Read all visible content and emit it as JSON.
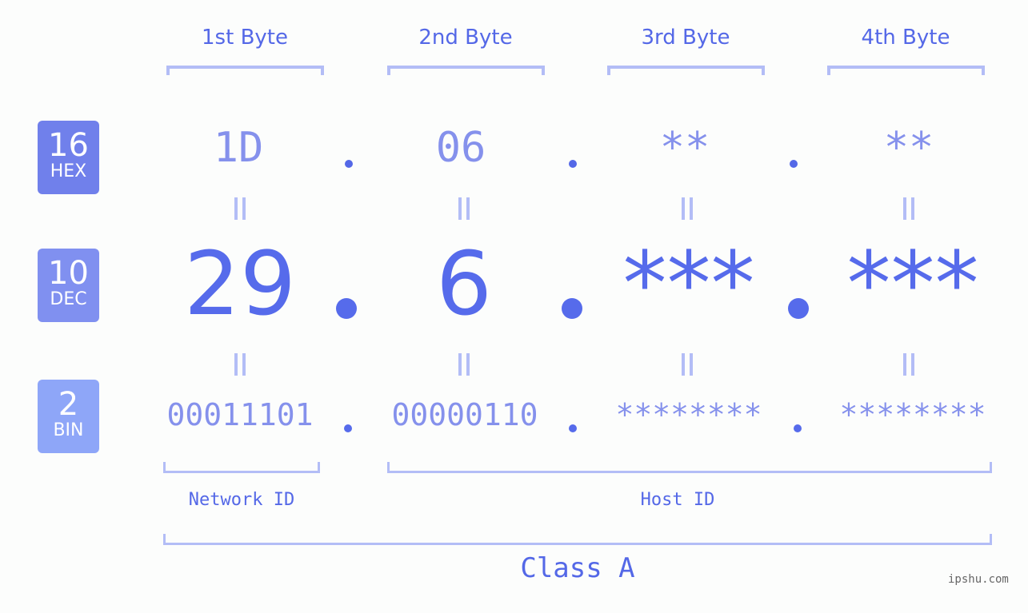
{
  "bytes": {
    "headers": [
      "1st Byte",
      "2nd Byte",
      "3rd Byte",
      "4th Byte"
    ]
  },
  "badges": {
    "hex": {
      "num": "16",
      "label": "HEX",
      "color": "#7080eb"
    },
    "dec": {
      "num": "10",
      "label": "DEC",
      "color": "#8090f0"
    },
    "bin": {
      "num": "2",
      "label": "BIN",
      "color": "#8ea6f8"
    }
  },
  "hex": {
    "values": [
      "1D",
      "06",
      "**",
      "**"
    ]
  },
  "dec": {
    "values": [
      "29",
      "6",
      "***",
      "***"
    ]
  },
  "bin": {
    "values": [
      "00011101",
      "00000110",
      "********",
      "********"
    ]
  },
  "separator": ".",
  "labels": {
    "network_id": "Network ID",
    "host_id": "Host ID",
    "class": "Class A"
  },
  "watermark": "ipshu.com",
  "colors": {
    "accent": "#566beb",
    "light_accent": "#8591ec",
    "bracket": "#b3bdf6",
    "background": "#fcfdfc"
  }
}
